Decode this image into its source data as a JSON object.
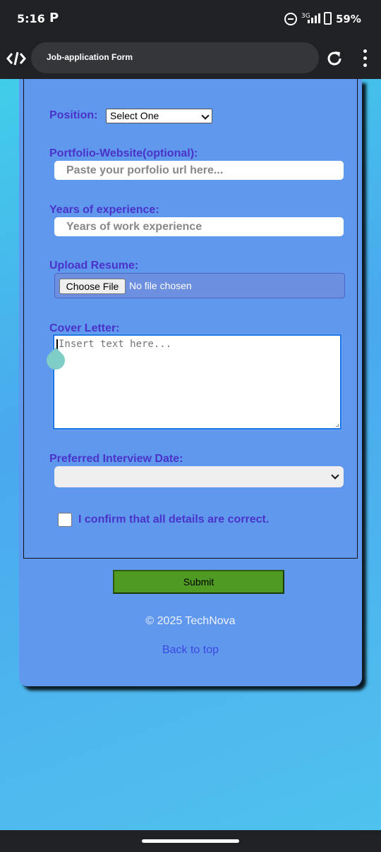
{
  "status_bar": {
    "time": "5:16",
    "app_icon": "P",
    "network": "3G",
    "battery_percent": "59%"
  },
  "browser": {
    "page_title": "Job-application Form",
    "logo_icon": "code-brackets-icon",
    "reload_icon": "reload-icon",
    "menu_icon": "more-vert-icon"
  },
  "form": {
    "position_label": "Position:",
    "position_selected": "Select One",
    "portfolio_label": "Portfolio-Website(optional):",
    "portfolio_placeholder": "Paste your porfolio url here...",
    "experience_label": "Years of experience:",
    "experience_placeholder": "Years of work experience",
    "resume_label": "Upload Resume:",
    "file_button": "Choose File",
    "file_status": "No file chosen",
    "cover_label": "Cover Letter:",
    "cover_placeholder": "Insert text here...",
    "interview_label": "Preferred Interview Date:",
    "interview_selected": "",
    "confirm_label": "I confirm that all details are correct.",
    "confirm_checked": false,
    "submit_label": "Submit"
  },
  "footer": {
    "copyright": "© 2025 TechNova",
    "back_to_top": "Back to top"
  },
  "colors": {
    "card_bg": "#6098ee",
    "label_color": "#4a33c9",
    "submit_bg": "#4e9a22",
    "link_color": "#3b48e0"
  }
}
